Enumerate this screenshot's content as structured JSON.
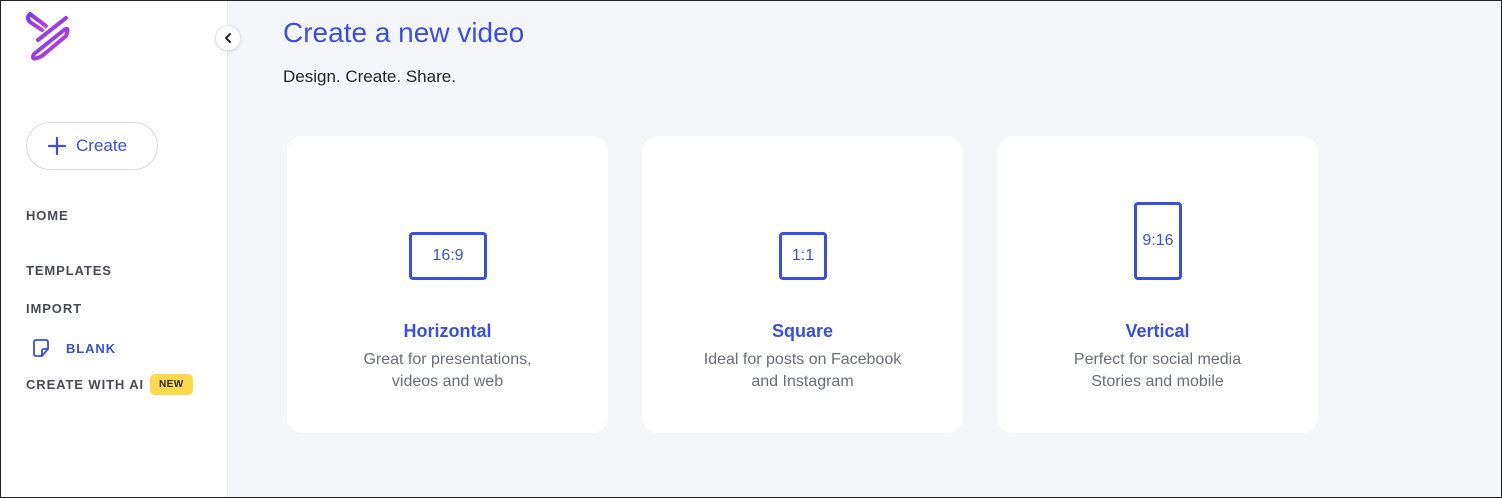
{
  "sidebar": {
    "create_label": "Create",
    "nav": {
      "home": "HOME",
      "templates": "TEMPLATES",
      "import": "IMPORT",
      "blank": "BLANK",
      "create_ai": "CREATE WITH AI",
      "new_badge": "NEW"
    }
  },
  "main": {
    "title": "Create a new video",
    "subtitle": "Design. Create. Share."
  },
  "cards": {
    "horizontal": {
      "ratio": "16:9",
      "title": "Horizontal",
      "line1": "Great for presentations,",
      "line2": "videos and web"
    },
    "square": {
      "ratio": "1:1",
      "title": "Square",
      "line1": "Ideal for posts on Facebook",
      "line2": "and Instagram"
    },
    "vertical": {
      "ratio": "9:16",
      "title": "Vertical",
      "line1": "Perfect for social media",
      "line2": "Stories and mobile"
    }
  },
  "colors": {
    "accent": "#3b4ee0",
    "badge": "#fcd94a",
    "background": "#f5f6fa"
  },
  "icons": [
    "app-logo-icon",
    "chevron-left-icon",
    "plus-icon",
    "blank-document-icon"
  ]
}
